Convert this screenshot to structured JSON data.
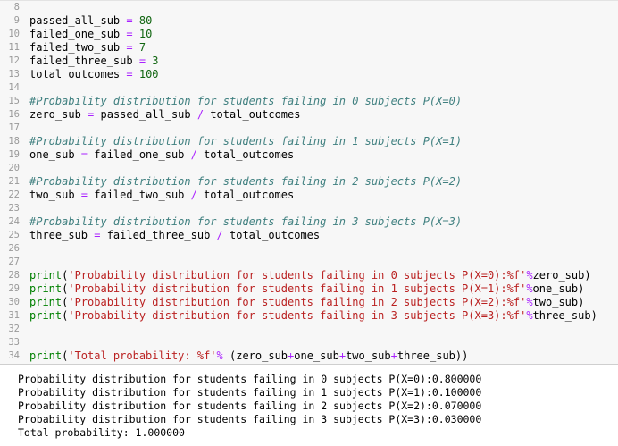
{
  "editor": {
    "lines": [
      {
        "num": "8",
        "parts": []
      },
      {
        "num": "9",
        "parts": [
          {
            "t": "passed_all_sub ",
            "c": ""
          },
          {
            "t": "=",
            "c": "op"
          },
          {
            "t": " ",
            "c": ""
          },
          {
            "t": "80",
            "c": "num"
          }
        ]
      },
      {
        "num": "10",
        "parts": [
          {
            "t": "failed_one_sub ",
            "c": ""
          },
          {
            "t": "=",
            "c": "op"
          },
          {
            "t": " ",
            "c": ""
          },
          {
            "t": "10",
            "c": "num"
          }
        ]
      },
      {
        "num": "11",
        "parts": [
          {
            "t": "failed_two_sub ",
            "c": ""
          },
          {
            "t": "=",
            "c": "op"
          },
          {
            "t": " ",
            "c": ""
          },
          {
            "t": "7",
            "c": "num"
          }
        ]
      },
      {
        "num": "12",
        "parts": [
          {
            "t": "failed_three_sub ",
            "c": ""
          },
          {
            "t": "=",
            "c": "op"
          },
          {
            "t": " ",
            "c": ""
          },
          {
            "t": "3",
            "c": "num"
          }
        ]
      },
      {
        "num": "13",
        "parts": [
          {
            "t": "total_outcomes ",
            "c": ""
          },
          {
            "t": "=",
            "c": "op"
          },
          {
            "t": " ",
            "c": ""
          },
          {
            "t": "100",
            "c": "num"
          }
        ]
      },
      {
        "num": "14",
        "parts": []
      },
      {
        "num": "15",
        "parts": [
          {
            "t": "#Probability distribution for students failing in 0 subjects P(X=0)",
            "c": "com"
          }
        ]
      },
      {
        "num": "16",
        "parts": [
          {
            "t": "zero_sub ",
            "c": ""
          },
          {
            "t": "=",
            "c": "op"
          },
          {
            "t": " passed_all_sub ",
            "c": ""
          },
          {
            "t": "/",
            "c": "op"
          },
          {
            "t": " total_outcomes",
            "c": ""
          }
        ]
      },
      {
        "num": "17",
        "parts": []
      },
      {
        "num": "18",
        "parts": [
          {
            "t": "#Probability distribution for students failing in 1 subjects P(X=1)",
            "c": "com"
          }
        ]
      },
      {
        "num": "19",
        "parts": [
          {
            "t": "one_sub ",
            "c": ""
          },
          {
            "t": "=",
            "c": "op"
          },
          {
            "t": " failed_one_sub ",
            "c": ""
          },
          {
            "t": "/",
            "c": "op"
          },
          {
            "t": " total_outcomes",
            "c": ""
          }
        ]
      },
      {
        "num": "20",
        "parts": []
      },
      {
        "num": "21",
        "parts": [
          {
            "t": "#Probability distribution for students failing in 2 subjects P(X=2)",
            "c": "com"
          }
        ]
      },
      {
        "num": "22",
        "parts": [
          {
            "t": "two_sub ",
            "c": ""
          },
          {
            "t": "=",
            "c": "op"
          },
          {
            "t": " failed_two_sub ",
            "c": ""
          },
          {
            "t": "/",
            "c": "op"
          },
          {
            "t": " total_outcomes",
            "c": ""
          }
        ]
      },
      {
        "num": "23",
        "parts": []
      },
      {
        "num": "24",
        "parts": [
          {
            "t": "#Probability distribution for students failing in 3 subjects P(X=3)",
            "c": "com"
          }
        ]
      },
      {
        "num": "25",
        "parts": [
          {
            "t": "three_sub ",
            "c": ""
          },
          {
            "t": "=",
            "c": "op"
          },
          {
            "t": " failed_three_sub ",
            "c": ""
          },
          {
            "t": "/",
            "c": "op"
          },
          {
            "t": " total_outcomes",
            "c": ""
          }
        ]
      },
      {
        "num": "26",
        "parts": []
      },
      {
        "num": "27",
        "parts": []
      },
      {
        "num": "28",
        "parts": [
          {
            "t": "print",
            "c": "kw"
          },
          {
            "t": "(",
            "c": ""
          },
          {
            "t": "'Probability distribution for students failing in 0 subjects P(X=0):%f'",
            "c": "str"
          },
          {
            "t": "%",
            "c": "op"
          },
          {
            "t": "zero_sub)",
            "c": ""
          }
        ]
      },
      {
        "num": "29",
        "parts": [
          {
            "t": "print",
            "c": "kw"
          },
          {
            "t": "(",
            "c": ""
          },
          {
            "t": "'Probability distribution for students failing in 1 subjects P(X=1):%f'",
            "c": "str"
          },
          {
            "t": "%",
            "c": "op"
          },
          {
            "t": "one_sub)",
            "c": ""
          }
        ]
      },
      {
        "num": "30",
        "parts": [
          {
            "t": "print",
            "c": "kw"
          },
          {
            "t": "(",
            "c": ""
          },
          {
            "t": "'Probability distribution for students failing in 2 subjects P(X=2):%f'",
            "c": "str"
          },
          {
            "t": "%",
            "c": "op"
          },
          {
            "t": "two_sub)",
            "c": ""
          }
        ]
      },
      {
        "num": "31",
        "parts": [
          {
            "t": "print",
            "c": "kw"
          },
          {
            "t": "(",
            "c": ""
          },
          {
            "t": "'Probability distribution for students failing in 3 subjects P(X=3):%f'",
            "c": "str"
          },
          {
            "t": "%",
            "c": "op"
          },
          {
            "t": "three_sub)",
            "c": ""
          }
        ]
      },
      {
        "num": "32",
        "parts": []
      },
      {
        "num": "33",
        "parts": []
      },
      {
        "num": "34",
        "parts": [
          {
            "t": "print",
            "c": "kw"
          },
          {
            "t": "(",
            "c": ""
          },
          {
            "t": "'Total probability: %f'",
            "c": "str"
          },
          {
            "t": "%",
            "c": "op"
          },
          {
            "t": " (zero_sub",
            "c": ""
          },
          {
            "t": "+",
            "c": "op"
          },
          {
            "t": "one_sub",
            "c": ""
          },
          {
            "t": "+",
            "c": "op"
          },
          {
            "t": "two_sub",
            "c": ""
          },
          {
            "t": "+",
            "c": "op"
          },
          {
            "t": "three_sub))",
            "c": ""
          }
        ]
      }
    ]
  },
  "output": {
    "lines": [
      "Probability distribution for students failing in 0 subjects P(X=0):0.800000",
      "Probability distribution for students failing in 1 subjects P(X=1):0.100000",
      "Probability distribution for students failing in 2 subjects P(X=2):0.070000",
      "Probability distribution for students failing in 3 subjects P(X=3):0.030000",
      "Total probability: 1.000000"
    ]
  },
  "colors": {
    "editor_bg": "#f7f7f7",
    "line_number": "#9a9a9a",
    "number_literal": "#116611",
    "operator": "#aa22ff",
    "keyword": "#008000",
    "string": "#ba2121",
    "comment": "#408080",
    "output_bg": "#ffffff"
  }
}
